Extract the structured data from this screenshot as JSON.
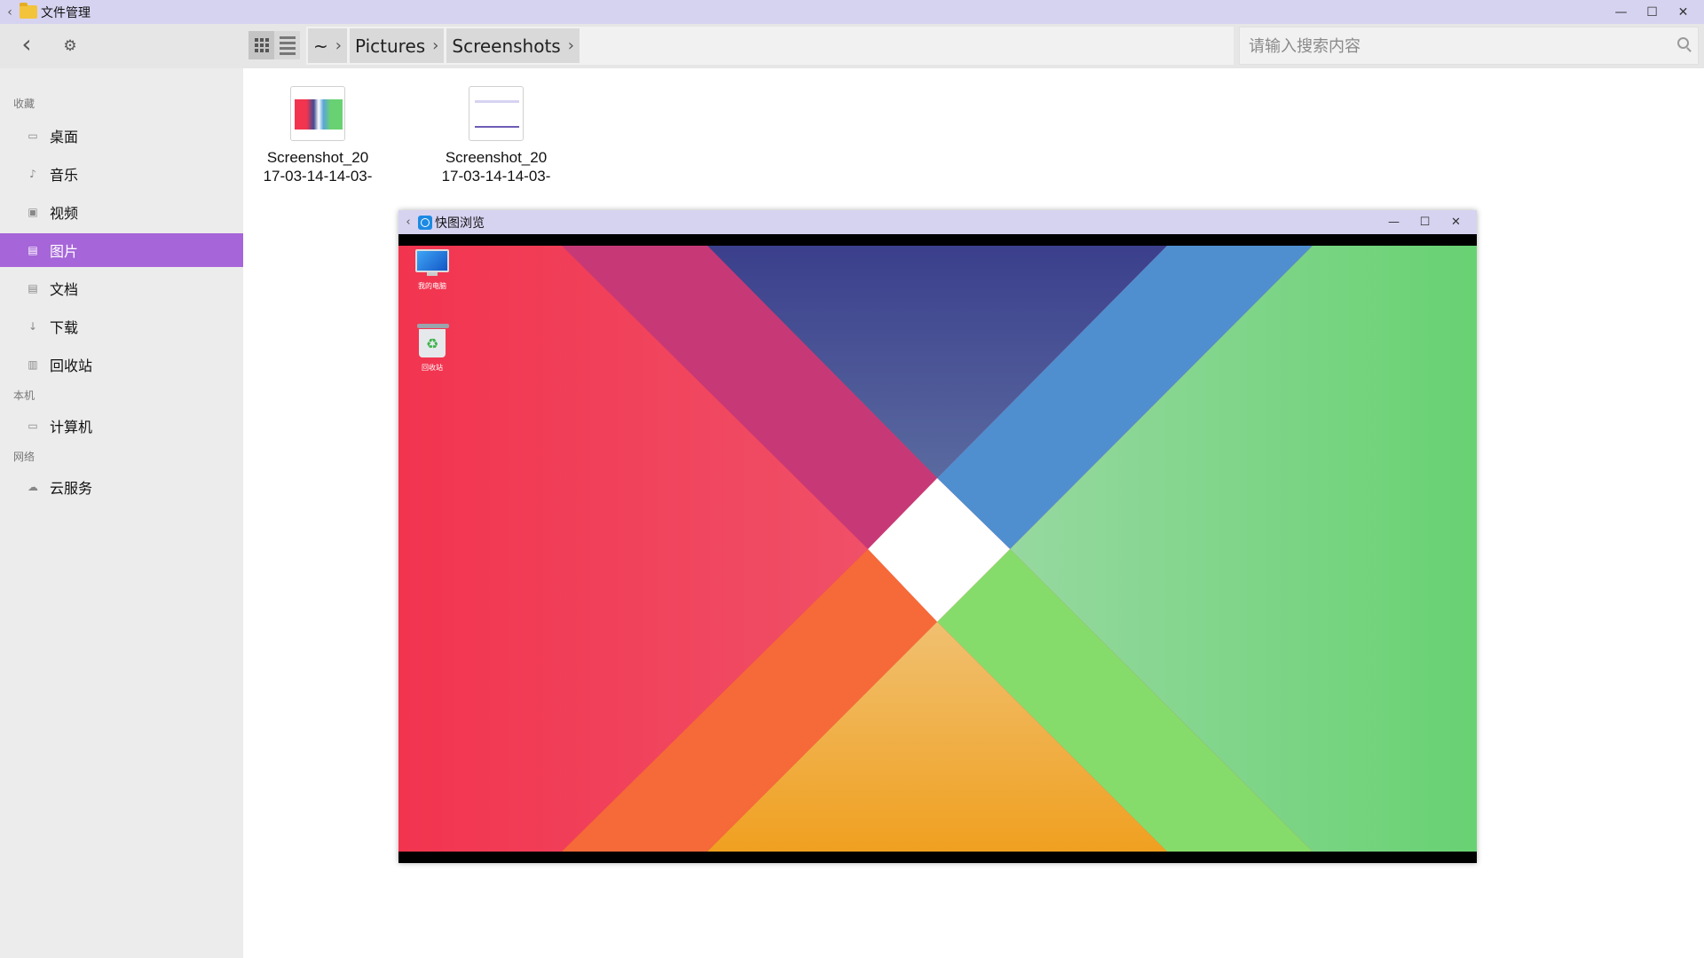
{
  "window": {
    "back_glyph": "‹",
    "title": "文件管理",
    "controls": {
      "minimize": "—",
      "maximize": "☐",
      "close": "✕"
    }
  },
  "toolbar": {
    "back_glyph": "‹",
    "settings_glyph": "⚙",
    "breadcrumbs": [
      {
        "label": "~",
        "chevron": "›"
      },
      {
        "label": "Pictures",
        "chevron": "›"
      },
      {
        "label": "Screenshots",
        "chevron": "›"
      }
    ]
  },
  "search": {
    "placeholder": "请输入搜索内容",
    "value": ""
  },
  "sidebar": {
    "sections": {
      "favorites": "收藏",
      "this_machine": "本机",
      "network": "网络"
    },
    "favorites": [
      {
        "label": "桌面",
        "icon": "desktop-icon",
        "glyph": "▭",
        "active": false
      },
      {
        "label": "音乐",
        "icon": "music-icon",
        "glyph": "♪",
        "active": false
      },
      {
        "label": "视频",
        "icon": "video-icon",
        "glyph": "▣",
        "active": false
      },
      {
        "label": "图片",
        "icon": "picture-icon",
        "glyph": "▤",
        "active": true
      },
      {
        "label": "文档",
        "icon": "document-icon",
        "glyph": "▤",
        "active": false
      },
      {
        "label": "下载",
        "icon": "download-icon",
        "glyph": "↓",
        "active": false
      },
      {
        "label": "回收站",
        "icon": "trash-icon",
        "glyph": "▥",
        "active": false
      }
    ],
    "this_machine": [
      {
        "label": "计算机",
        "icon": "computer-icon",
        "glyph": "▭"
      }
    ],
    "network": [
      {
        "label": "云服务",
        "icon": "cloud-icon",
        "glyph": "☁"
      }
    ]
  },
  "files": [
    {
      "name_line1": "Screenshot_20",
      "name_line2": "17-03-14-14-03-",
      "thumb": "desktop-wallpaper"
    },
    {
      "name_line1": "Screenshot_20",
      "name_line2": "17-03-14-14-03-",
      "thumb": "file-manager-window"
    }
  ],
  "viewer": {
    "back_glyph": "‹",
    "title": "快图浏览",
    "controls": {
      "minimize": "—",
      "maximize": "☐",
      "close": "✕"
    },
    "desktop_icons": [
      {
        "label": "我的电脑",
        "icon": "monitor-icon"
      },
      {
        "label": "回收站",
        "icon": "recycle-bin-icon"
      }
    ],
    "wallpaper_colors": {
      "left": "#f2344f",
      "top": "#3f4b93",
      "right": "#68d272",
      "bottom": "#f0a020",
      "center": "#ffffff"
    }
  },
  "colors": {
    "titlebar": "#d6d3f1",
    "sidebar_active": "#a665d8"
  }
}
